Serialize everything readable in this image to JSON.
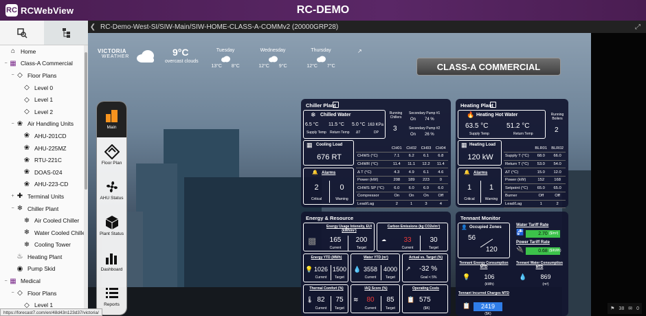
{
  "app": {
    "logo_text": "RCWebView",
    "title": "RC-DEMO"
  },
  "path": "RC-Demo-West-SI/SIW-Main/SIW-HOME-CLASS-A-COMMv2 (20000GRP28)",
  "sidebar": {
    "items": [
      {
        "label": "Home",
        "icon": "home-icon",
        "level": 0,
        "chev": ""
      },
      {
        "label": "Class-A Commercial",
        "icon": "building-icon",
        "level": 0,
        "chev": "−"
      },
      {
        "label": "Floor Plans",
        "icon": "floorplan-icon",
        "level": 1,
        "chev": "−"
      },
      {
        "label": "Level 0",
        "icon": "floorplan-icon",
        "level": 2,
        "chev": ""
      },
      {
        "label": "Level 1",
        "icon": "floorplan-icon",
        "level": 2,
        "chev": ""
      },
      {
        "label": "Level 2",
        "icon": "floorplan-icon",
        "level": 2,
        "chev": ""
      },
      {
        "label": "Air Handling Units",
        "icon": "fan-icon",
        "level": 1,
        "chev": "−"
      },
      {
        "label": "AHU-201CD",
        "icon": "fan-icon",
        "level": 2,
        "chev": ""
      },
      {
        "label": "AHU-225MZ",
        "icon": "fan-icon",
        "level": 2,
        "chev": ""
      },
      {
        "label": "RTU-221C",
        "icon": "fan-icon",
        "level": 2,
        "chev": ""
      },
      {
        "label": "DOAS-024",
        "icon": "fan-icon",
        "level": 2,
        "chev": ""
      },
      {
        "label": "AHU-223-CD",
        "icon": "fan-icon",
        "level": 2,
        "chev": ""
      },
      {
        "label": "Terminal Units",
        "icon": "terminal-icon",
        "level": 1,
        "chev": "+"
      },
      {
        "label": "Chiller Plant",
        "icon": "snowflake-icon",
        "level": 1,
        "chev": "−"
      },
      {
        "label": "Air Cooled Chiller",
        "icon": "snowflake-icon",
        "level": 2,
        "chev": ""
      },
      {
        "label": "Water Cooled Chiller",
        "icon": "snowflake-icon",
        "level": 2,
        "chev": ""
      },
      {
        "label": "Cooling Tower",
        "icon": "snowflake-icon",
        "level": 2,
        "chev": ""
      },
      {
        "label": "Heating Plant",
        "icon": "flame-icon",
        "level": 1,
        "chev": ""
      },
      {
        "label": "Pump Skid",
        "icon": "pump-icon",
        "level": 1,
        "chev": ""
      },
      {
        "label": "Medical",
        "icon": "building-icon",
        "level": 0,
        "chev": "−"
      },
      {
        "label": "Floor Plans",
        "icon": "floorplan-icon",
        "level": 1,
        "chev": "−"
      },
      {
        "label": "Level 1",
        "icon": "floorplan-icon",
        "level": 2,
        "chev": ""
      }
    ]
  },
  "weather": {
    "brand_top": "VICTORIA",
    "brand_bottom": "WEATHER",
    "temp": "9°C",
    "condition": "overcast clouds",
    "days": [
      {
        "name": "Tuesday",
        "high": "13°C",
        "low": "8°C"
      },
      {
        "name": "Wednesday",
        "high": "12°C",
        "low": "9°C"
      },
      {
        "name": "Thursday",
        "high": "12°C",
        "low": "7°C"
      }
    ]
  },
  "banner": "CLASS-A COMMERCIAL",
  "dock": [
    "Main",
    "Floor Plan",
    "AHU Status",
    "Plant Status",
    "Dashboard",
    "Reports"
  ],
  "chiller": {
    "title": "Chiller Plant",
    "chilled_water": "Chilled Water",
    "supply_temp": "6.5 °C",
    "supply_label": "Supply Temp",
    "return_temp": "11.5 °C",
    "return_label": "Return Temp",
    "dt": "5.0 °C",
    "dt_label": "ΔT",
    "dp": "163 KPa",
    "dp_label": "DP",
    "running_label": "Running Chillers",
    "running": "3",
    "sec_pump1_label": "Secondary Pump #1",
    "sec_pump1_state": "On",
    "sec_pump1_pct": "74 %",
    "sec_pump2_label": "Secondary Pump #2",
    "sec_pump2_state": "On",
    "sec_pump2_pct": "26 %",
    "cooling_load_label": "Cooling Load",
    "cooling_load": "676 RT",
    "alarms_label": "Alarms",
    "critical": "2",
    "critical_label": "Critical",
    "warning": "0",
    "warning_label": "Warning",
    "table": {
      "headers": [
        "CH01",
        "CH02",
        "CH03",
        "CH04"
      ],
      "rows": [
        {
          "label": "CHWS (°C)",
          "values": [
            "7.1",
            "6.2",
            "6.1",
            "6.8"
          ]
        },
        {
          "label": "CHWR (°C)",
          "values": [
            "11.4",
            "11.1",
            "12.2",
            "11.4"
          ]
        },
        {
          "label": "Δ T (°C)",
          "values": [
            "4.3",
            "4.9",
            "6.1",
            "4.6"
          ]
        },
        {
          "label": "Power (kW)",
          "values": [
            "208",
            "189",
            "223",
            "0"
          ]
        },
        {
          "label": "CHWS SP (°C)",
          "values": [
            "6.0",
            "6.0",
            "6.0",
            "6.0"
          ]
        },
        {
          "label": "Compressor",
          "values": [
            "On",
            "On",
            "On",
            "Off"
          ]
        },
        {
          "label": "Lead/Lag",
          "values": [
            "2",
            "1",
            "3",
            "4"
          ]
        }
      ]
    }
  },
  "heating": {
    "title": "Heating Plant",
    "hot_water": "Heating Hot Water",
    "supply_temp": "63.5 °C",
    "supply_label": "Supply Temp",
    "return_temp": "51.2 °C",
    "return_label": "Return Temp",
    "running_label": "Running Boilers",
    "running": "2",
    "heating_load_label": "Heating Load",
    "heating_load": "120 kW",
    "alarms_label": "Alarms",
    "critical": "1",
    "critical_label": "Critical",
    "warning": "1",
    "warning_label": "Warning",
    "table": {
      "headers": [
        "BLR01",
        "BLR02"
      ],
      "rows": [
        {
          "label": "Supply T (°C)",
          "values": [
            "68.0",
            "66.0"
          ]
        },
        {
          "label": "Return T (°C)",
          "values": [
            "53.0",
            "54.0"
          ]
        },
        {
          "label": "ΔT (°C)",
          "values": [
            "15.0",
            "12.0"
          ]
        },
        {
          "label": "Power (kW)",
          "values": [
            "152",
            "168"
          ]
        },
        {
          "label": "Setpoint (°C)",
          "values": [
            "65.0",
            "65.0"
          ]
        },
        {
          "label": "Burner",
          "values": [
            "Off",
            "Off"
          ]
        },
        {
          "label": "Lead/Lag",
          "values": [
            "1",
            "2"
          ]
        }
      ]
    }
  },
  "energy": {
    "title": "Energy & Resource",
    "eui_label": "Energy Usage Intensity, EUI (kWh/m²)",
    "eui_current": "165",
    "eui_target": "200",
    "carbon_label": "Carbon Emissions (kg CO2e/m²)",
    "carbon_current": "33",
    "carbon_target": "30",
    "energy_ytd_label": "Energy YTD (MWh)",
    "energy_ytd_current": "1026",
    "energy_ytd_target": "1500",
    "water_ytd_label": "Water YTD (m³)",
    "water_ytd_current": "3558",
    "water_ytd_target": "4000",
    "actual_vs_target_label": "Actual vs. Target (%)",
    "actual_vs_target": "-32 %",
    "goal": "Goal < 5%",
    "comfort_label": "Thermal Comfort (%)",
    "comfort_current": "82",
    "comfort_target": "75",
    "iaq_label": "IAQ Score (%)",
    "iaq_current": "80",
    "iaq_target": "85",
    "opcost_label": "Operating Costs",
    "opcost": "575",
    "opcost_unit": "($K)",
    "current_label": "Current",
    "target_label": "Target"
  },
  "tenant": {
    "title": "Tennant Monitor",
    "occupied_label": "Occupied Zones",
    "occupied": "56",
    "total_zones": "120",
    "water_tariff_label": "Water Tariff Rate",
    "water_tariff": "2.70",
    "water_tariff_unit": "($/m³)",
    "power_tariff_label": "Power Tariff Rate",
    "power_tariff": "0.68",
    "power_tariff_unit": "($/kWh)",
    "energy_mtd_label": "Tennant Energy Consumption MTD",
    "energy_mtd": "106",
    "energy_mtd_unit": "(kWh)",
    "water_mtd_label": "Tennant Water Consumption MTD",
    "water_mtd": "869",
    "water_mtd_unit": "(m³)",
    "charges_label": "Tennant Incurred Charges MTD",
    "charges": "2419",
    "charges_unit": "($K)"
  },
  "status_url": "https://forecast7.com/en/48d43n123d37/victoria/",
  "counters": {
    "alarms": "38",
    "messages": "0"
  },
  "colors": {
    "header": "#5a2766",
    "panel": "#12162f",
    "alert": "#f03a3a",
    "tariff_green": "#3cc24a",
    "charges_blue": "#2f7de8"
  }
}
